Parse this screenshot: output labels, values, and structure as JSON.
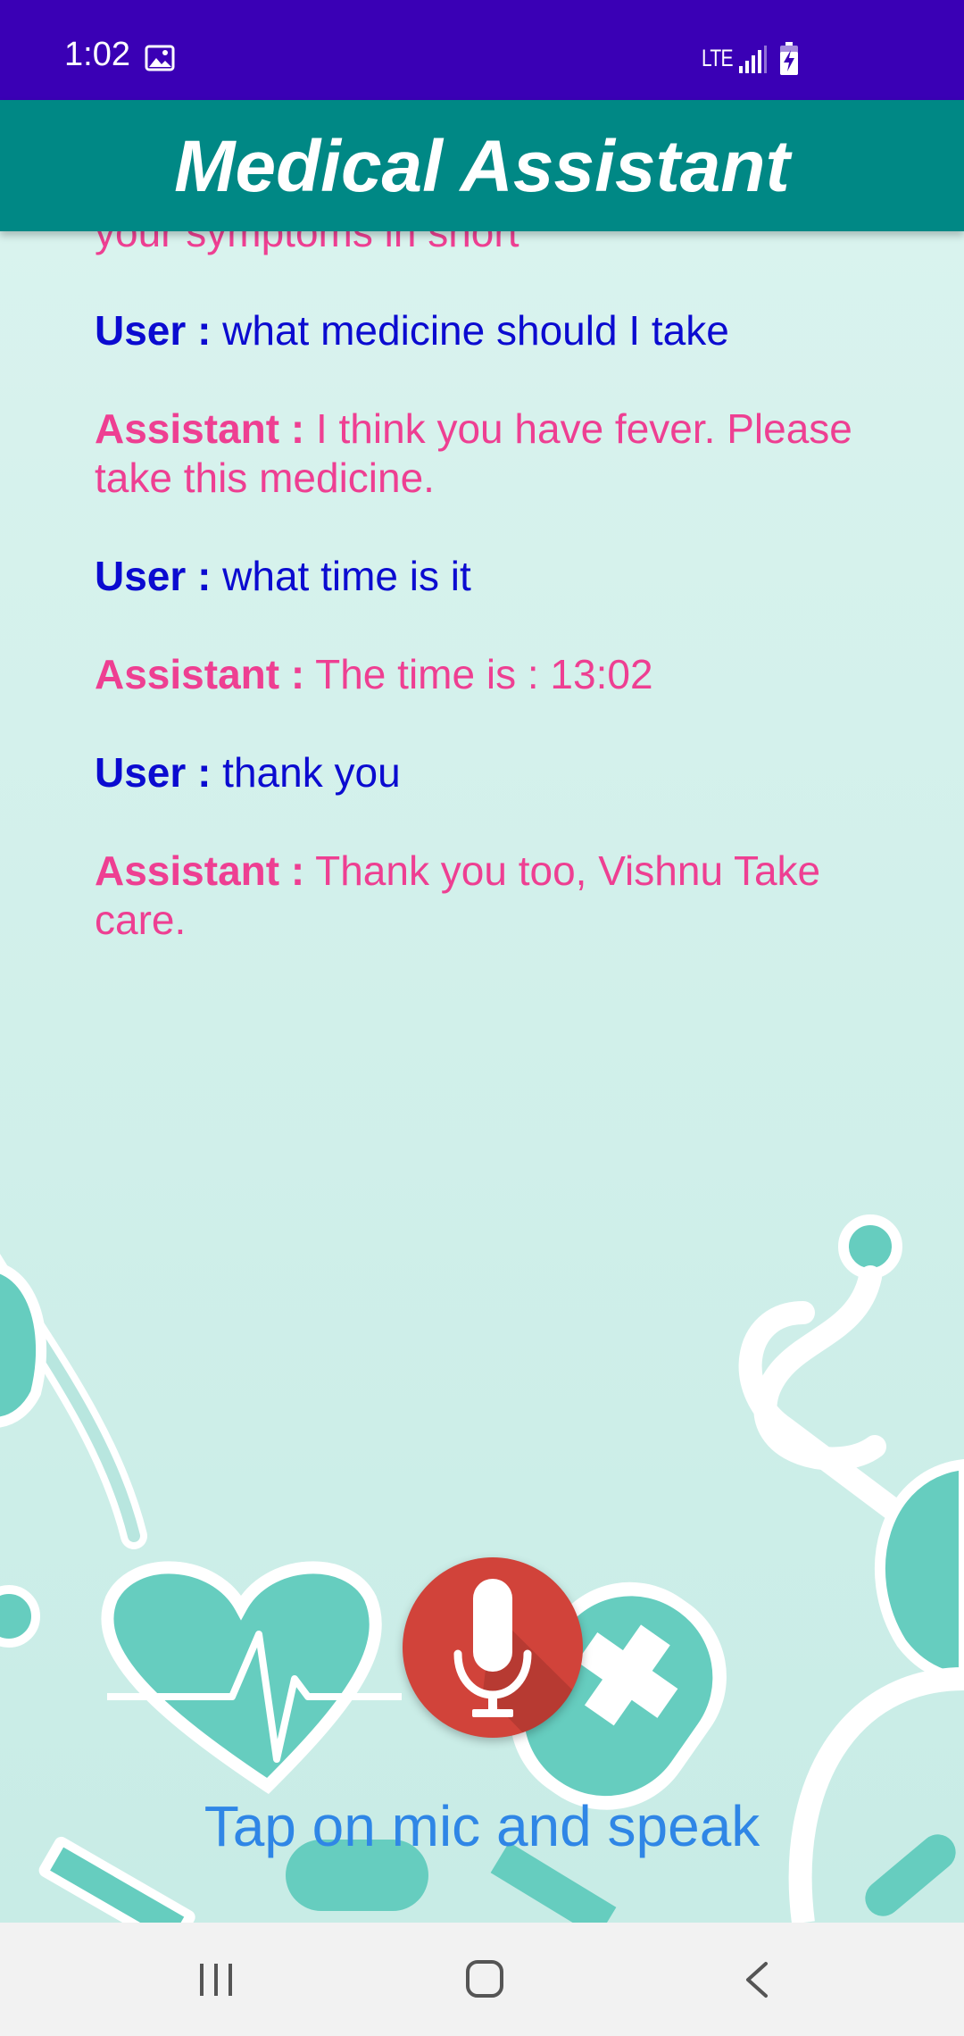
{
  "status_bar": {
    "time": "1:02",
    "network": "LTE",
    "icons": [
      "gallery-icon",
      "signal-icon",
      "battery-charging-icon"
    ],
    "background_color": "#3a00b5"
  },
  "app_bar": {
    "title": "Medical Assistant",
    "background_color": "#008885"
  },
  "conversation": {
    "partial_top_line": "your symptoms in short",
    "messages": [
      {
        "speaker": "User :",
        "text": "what medicine should I take",
        "role": "user"
      },
      {
        "speaker": "Assistant :",
        "text": "I think you have fever. Please take this medicine.",
        "role": "assistant"
      },
      {
        "speaker": "User :",
        "text": "what time is it",
        "role": "user"
      },
      {
        "speaker": "Assistant :",
        "text": "The time is : 13:02",
        "role": "assistant"
      },
      {
        "speaker": "User :",
        "text": "thank you",
        "role": "user"
      },
      {
        "speaker": "Assistant :",
        "text": "Thank you too, Vishnu Take care.",
        "role": "assistant"
      }
    ],
    "user_color": "#0b0bd0",
    "assistant_color": "#ee3f92"
  },
  "mic": {
    "icon": "microphone-icon",
    "button_color": "#d1433a",
    "hint": "Tap on mic and speak",
    "hint_color": "#2f86e6"
  },
  "nav_bar": {
    "icons": [
      "recent-apps-icon",
      "home-icon",
      "back-icon"
    ]
  }
}
